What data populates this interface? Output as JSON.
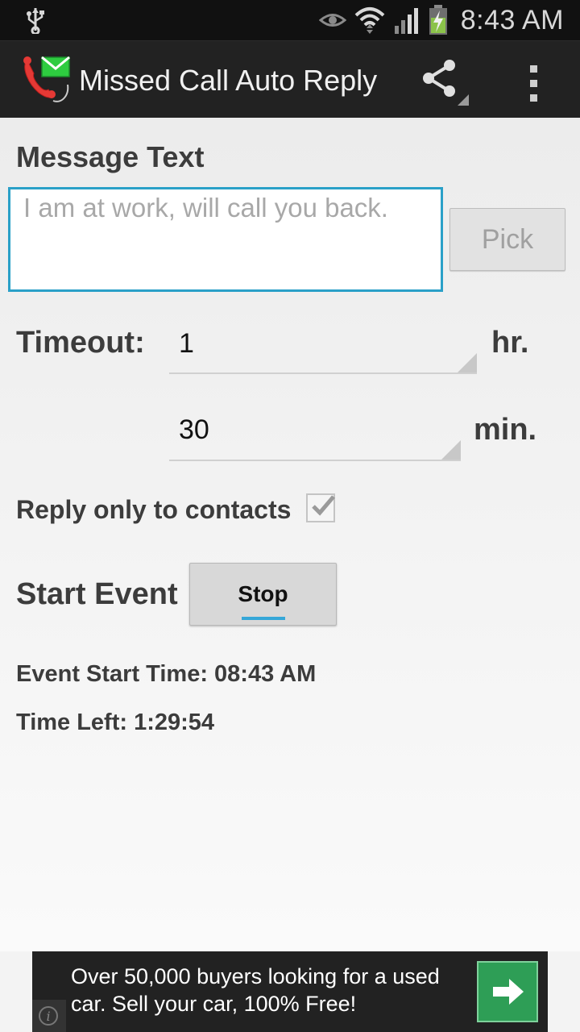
{
  "status_bar": {
    "time": "8:43 AM",
    "icons": [
      "usb-icon",
      "eye-icon",
      "wifi-icon",
      "signal-icon",
      "battery-charging-icon"
    ]
  },
  "action_bar": {
    "title": "Missed Call Auto Reply",
    "app_icon": "missed-call-sms-icon",
    "share_icon": "share-icon",
    "overflow_icon": "overflow-menu-icon"
  },
  "form": {
    "message_label": "Message Text",
    "message_placeholder": "I am at work, will call you back.",
    "message_value": "",
    "pick_label": "Pick",
    "timeout_label": "Timeout:",
    "hours_value": "1",
    "hours_unit": "hr.",
    "minutes_value": "30",
    "minutes_unit": "min.",
    "reply_contacts_label": "Reply only to contacts",
    "reply_contacts_checked": true,
    "start_event_label": "Start Event",
    "stop_label": "Stop",
    "event_start_time": "Event Start Time: 08:43 AM",
    "time_left": "Time Left: 1:29:54"
  },
  "ad": {
    "text": "Over 50,000 buyers looking for a used car. Sell your car, 100% Free!",
    "info_glyph": "i",
    "arrow_icon": "arrow-right-icon",
    "arrow_color": "#2e9e56"
  },
  "colors": {
    "accent": "#2aa0c8",
    "stop_indicator": "#35a7d8"
  }
}
